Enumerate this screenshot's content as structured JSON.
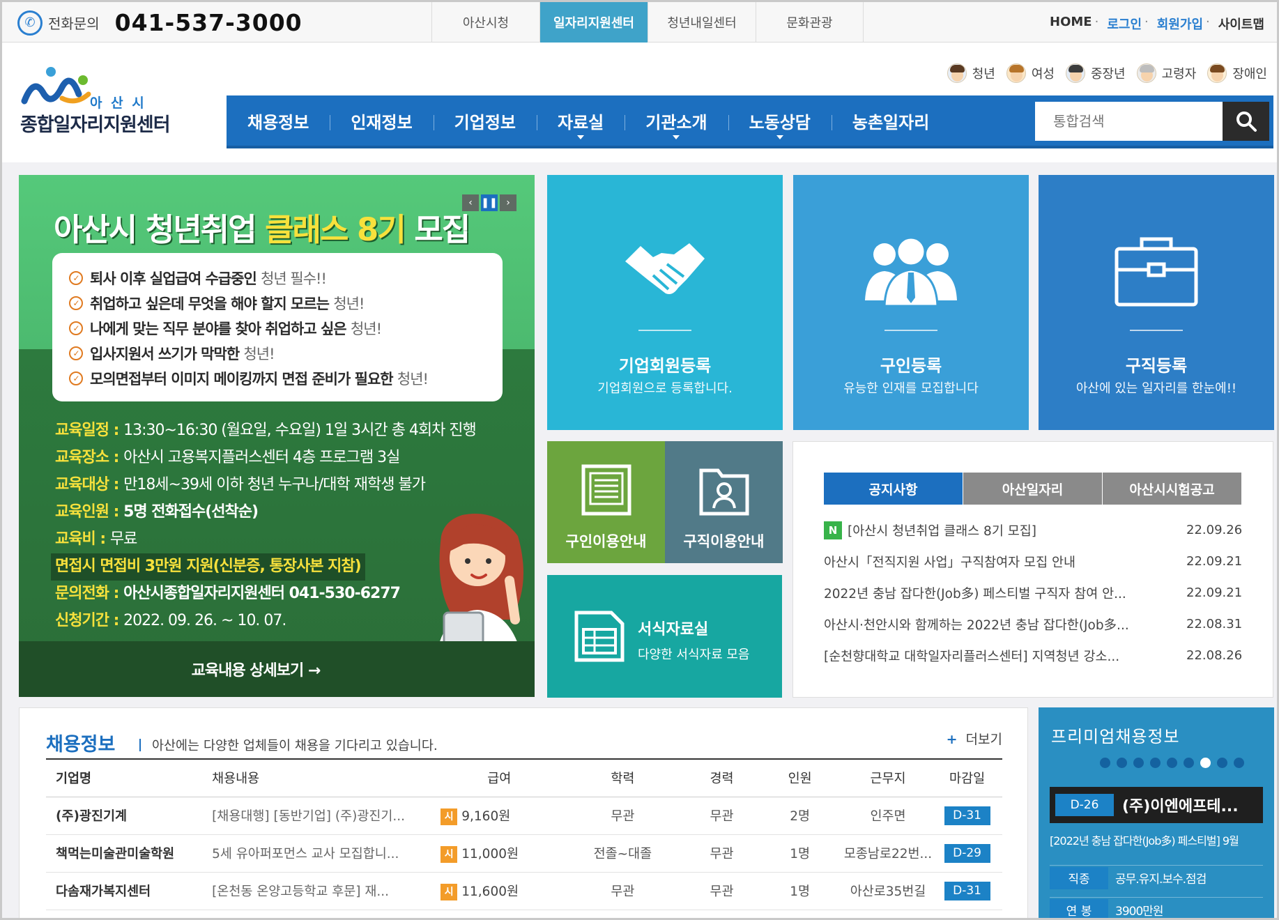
{
  "topbar": {
    "phone_label": "전화문의",
    "phone_number": "041-537-3000",
    "site_tabs": [
      "아산시청",
      "일자리지원센터",
      "청년내일센터",
      "문화관광"
    ],
    "active_tab_index": 1,
    "links": {
      "home": "HOME",
      "login": "로그인",
      "join": "회원가입",
      "sitemap": "사이트맵"
    }
  },
  "header": {
    "logo_city": "아 산 시",
    "logo_name": "종합일자리지원센터",
    "targets": [
      {
        "label": "청년",
        "icon": "youth-avatar-icon"
      },
      {
        "label": "여성",
        "icon": "woman-avatar-icon"
      },
      {
        "label": "중장년",
        "icon": "middle-aged-avatar-icon"
      },
      {
        "label": "고령자",
        "icon": "senior-avatar-icon"
      },
      {
        "label": "장애인",
        "icon": "disabled-avatar-icon"
      }
    ],
    "nav": [
      "채용정보",
      "인재정보",
      "기업정보",
      "자료실",
      "기관소개",
      "노동상담",
      "농촌일자리"
    ],
    "search_placeholder": "통합검색"
  },
  "banner": {
    "title_plain": "아산시 청년취업 ",
    "title_highlight": "클래스 8기",
    "title_end": " 모집",
    "checks": [
      {
        "strong": "퇴사 이후 실업급여 수급중인",
        "soft": "청년 필수!!"
      },
      {
        "strong": "취업하고 싶은데 무엇을 해야 할지 모르는",
        "soft": "청년!"
      },
      {
        "strong": "나에게 맞는 직무 분야를 찾아 취업하고 싶은",
        "soft": "청년!"
      },
      {
        "strong": "입사지원서 쓰기가 막막한",
        "soft": "청년!"
      },
      {
        "strong": "모의면접부터 이미지 메이킹까지 면접 준비가 필요한",
        "soft": "청년!"
      }
    ],
    "info": [
      {
        "k": "교육일정 : ",
        "v": "13:30~16:30 (월요일, 수요일) 1일 3시간 총 4회차 진행"
      },
      {
        "k": "교육장소 : ",
        "v": "아산시 고용복지플러스센터 4층 프로그램 3실"
      },
      {
        "k": "교육대상 : ",
        "v": "만18세~39세 이하 청년 누구나/대학 재학생 불가"
      },
      {
        "k": "교육인원 : ",
        "v": "5명 전화접수(선착순)"
      },
      {
        "k": "교육비 : ",
        "v": "무료"
      },
      {
        "k": "",
        "v": "면접시 면접비 3만원 지원(신분증, 통장사본 지참)"
      },
      {
        "k": "문의전화 : ",
        "v": "아산시종합일자리지원센터 041-530-6277"
      },
      {
        "k": "신청기간 : ",
        "v": "2022. 09. 26. ~ 10. 07."
      }
    ],
    "cta": "교육내용 상세보기 →"
  },
  "tiles": {
    "company": {
      "title": "기업회원등록",
      "desc": "기업회원으로 등록합니다.",
      "color": "#29b6d6"
    },
    "hire": {
      "title": "구인등록",
      "desc": "유능한 인재를 모집합니다",
      "color": "#3a9fd8"
    },
    "seek": {
      "title": "구직등록",
      "desc": "아산에 있는 일자리를 한눈에!!",
      "color": "#2d7ec6"
    },
    "hire_guide": {
      "title": "구인이용안내",
      "color": "#6ca53e"
    },
    "seek_guide": {
      "title": "구직이용안내",
      "color": "#517a88"
    },
    "forms": {
      "title": "서식자료실",
      "desc": "다양한 서식자료 모음",
      "color": "#17a7a1"
    }
  },
  "notice": {
    "tabs": [
      "공지사항",
      "아산일자리",
      "아산시시험공고"
    ],
    "new_badge": "N",
    "items": [
      {
        "title": "[아산시 청년취업 클래스 8기 모집]",
        "date": "22.09.26",
        "is_new": true
      },
      {
        "title": "아산시「전직지원 사업」구직참여자 모집 안내",
        "date": "22.09.21",
        "is_new": false
      },
      {
        "title": "2022년 충남 잡다한(Job多) 페스티벌 구직자 참여 안...",
        "date": "22.09.21",
        "is_new": false
      },
      {
        "title": "아산시·천안시와 함께하는 2022년 충남 잡다한(Job多...",
        "date": "22.08.31",
        "is_new": false
      },
      {
        "title": "[순천향대학교 대학일자리플러스센터] 지역청년 강소...",
        "date": "22.08.26",
        "is_new": false
      }
    ]
  },
  "jobs": {
    "title": "채용정보",
    "desc": "아산에는 다양한 업체들이 채용을 기다리고 있습니다.",
    "more": "더보기",
    "columns": [
      "기업명",
      "채용내용",
      "급여",
      "학력",
      "경력",
      "인원",
      "근무지",
      "마감일"
    ],
    "rows": [
      {
        "company": "(주)광진기계",
        "job": "[채용대행] [동반기업] (주)광진기...",
        "pay_type": "시",
        "pay": "9,160원",
        "edu": "무관",
        "career": "무관",
        "count": "2명",
        "place": "인주면",
        "dday": "D-31"
      },
      {
        "company": "책먹는미술관미술학원",
        "job": "5세 유아퍼포먼스 교사 모집합니...",
        "pay_type": "시",
        "pay": "11,000원",
        "edu": "전졸~대졸",
        "career": "무관",
        "count": "1명",
        "place": "모종남로22번...",
        "dday": "D-29"
      },
      {
        "company": "다솜재가복지센터",
        "job": "[온천동 온양고등학교 후문] 재...",
        "pay_type": "시",
        "pay": "11,600원",
        "edu": "무관",
        "career": "무관",
        "count": "1명",
        "place": "아산로35번길",
        "dday": "D-31"
      }
    ]
  },
  "premium": {
    "title": "프리미엄채용정보",
    "dots": 9,
    "active_dot": 6,
    "dday": "D-26",
    "company": "(주)이엔에프테...",
    "subtitle": "[2022년 충남 잡다한(Job多) 페스티벌] 9월",
    "rows": [
      {
        "k": "직종",
        "v": "공무.유지.보수.점검"
      },
      {
        "k": "연 봉",
        "v": "3900만원"
      }
    ]
  }
}
